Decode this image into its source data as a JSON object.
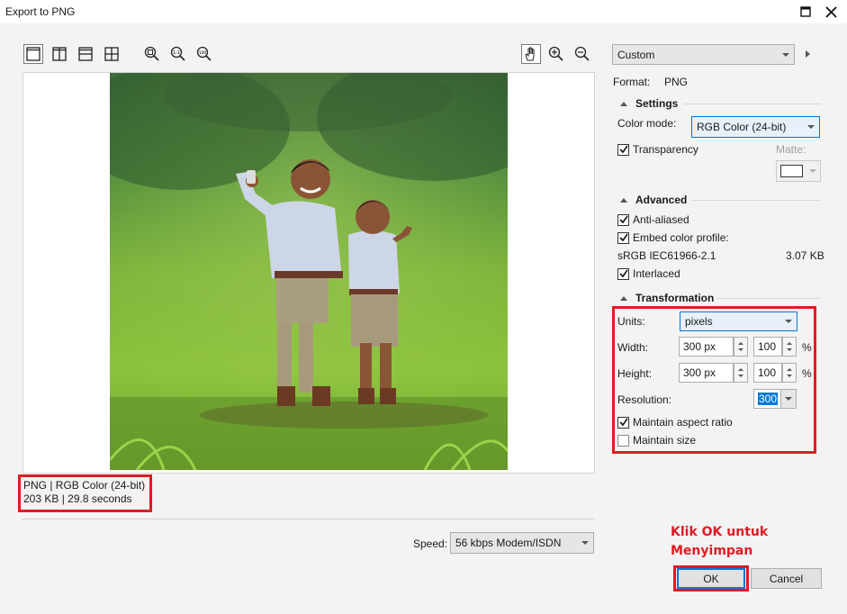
{
  "window": {
    "title": "Export to PNG"
  },
  "toolbar": {
    "view_icons": [
      "single-view-icon",
      "split-vertical-icon",
      "split-horizontal-icon",
      "quad-view-icon"
    ],
    "zoom_icons": [
      "zoom-fit-icon",
      "zoom-1to1-icon",
      "zoom-100-icon"
    ],
    "right_icons": [
      "pan-hand-icon",
      "zoom-in-icon",
      "zoom-out-icon"
    ]
  },
  "preview_info": {
    "line1": "PNG  |  RGB Color (24-bit)",
    "line2": "203 KB  |  29.8 seconds"
  },
  "speed": {
    "label": "Speed:",
    "value": "56 kbps Modem/ISDN"
  },
  "preset": {
    "value": "Custom"
  },
  "format": {
    "label": "Format:",
    "value": "PNG"
  },
  "settings": {
    "heading": "Settings",
    "color_mode_label": "Color mode:",
    "color_mode_value": "RGB Color (24-bit)",
    "transparency_label": "Transparency",
    "transparency_checked": true,
    "matte_label": "Matte:"
  },
  "advanced": {
    "heading": "Advanced",
    "anti_aliased_label": "Anti-aliased",
    "anti_aliased_checked": true,
    "embed_profile_label": "Embed color profile:",
    "embed_profile_checked": true,
    "profile_name": "sRGB IEC61966-2.1",
    "profile_size": "3.07 KB",
    "interlaced_label": "Interlaced",
    "interlaced_checked": true
  },
  "transformation": {
    "heading": "Transformation",
    "units_label": "Units:",
    "units_value": "pixels",
    "width_label": "Width:",
    "width_value": "300 px",
    "width_percent": "100",
    "height_label": "Height:",
    "height_value": "300 px",
    "height_percent": "100",
    "percent_sign": "%",
    "resolution_label": "Resolution:",
    "resolution_value": "300",
    "maintain_aspect_label": "Maintain aspect ratio",
    "maintain_aspect_checked": true,
    "maintain_size_label": "Maintain size",
    "maintain_size_checked": false
  },
  "annotation": {
    "line1": "Klik OK untuk",
    "line2": "Menyimpan"
  },
  "buttons": {
    "ok": "OK",
    "cancel": "Cancel"
  },
  "colors": {
    "annotation_red": "#e01b24",
    "focus_blue": "#0078d7"
  }
}
